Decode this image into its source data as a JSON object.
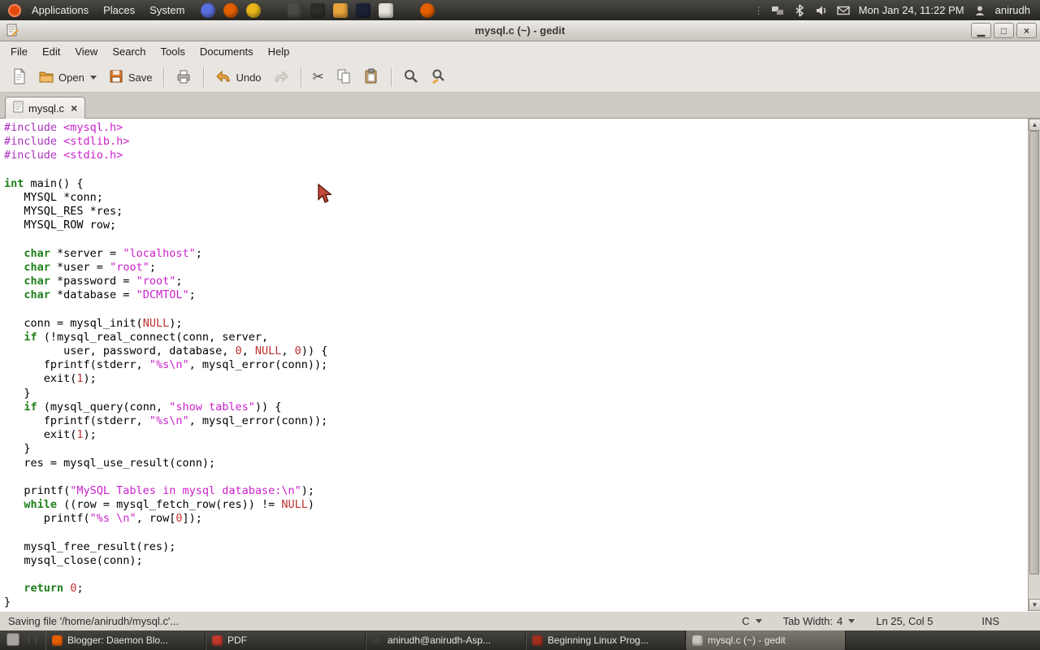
{
  "top_panel": {
    "menus": [
      "Applications",
      "Places",
      "System"
    ],
    "launchers": [
      {
        "name": "gimp-icon",
        "color": "#5b6ee1",
        "shape": "circle"
      },
      {
        "name": "firefox-icon",
        "color": "#e66000",
        "shape": "circle"
      },
      {
        "name": "software-center-icon",
        "color": "#e8b71a",
        "shape": "circle"
      },
      {
        "name": "display-icon",
        "color": "#4a4a46",
        "shape": "square",
        "gap": true
      },
      {
        "name": "terminal-launcher-icon",
        "color": "#2d2d2a",
        "shape": "square"
      },
      {
        "name": "home-folder-icon",
        "color": "#e8a33d",
        "shape": "square"
      },
      {
        "name": "screenshot-icon",
        "color": "#1c2236",
        "shape": "square"
      },
      {
        "name": "text-editor-icon",
        "color": "#e6e3da",
        "shape": "square"
      },
      {
        "name": "firefox-launcher-icon",
        "color": "#e66000",
        "shape": "circle",
        "gap": true
      }
    ],
    "indicator_icons": [
      "network-icon",
      "bluetooth-icon",
      "volume-icon",
      "mail-icon"
    ],
    "clock": "Mon Jan 24, 11:22 PM",
    "user": "anirudh"
  },
  "window": {
    "title": "mysql.c (~) - gedit",
    "menus": [
      "File",
      "Edit",
      "View",
      "Search",
      "Tools",
      "Documents",
      "Help"
    ],
    "toolbar": {
      "open_label": "Open",
      "save_label": "Save",
      "undo_label": "Undo"
    },
    "tab": {
      "label": "mysql.c"
    }
  },
  "statusbar": {
    "message": "Saving file '/home/anirudh/mysql.c'...",
    "language": "C",
    "tab_width_label": "Tab Width:",
    "tab_width": "4",
    "position": "Ln 25, Col 5",
    "mode": "INS"
  },
  "taskbar": {
    "items": [
      {
        "label": "Blogger: Daemon Blo...",
        "icon": "firefox-task-icon",
        "icon_color": "#e66000",
        "active": false
      },
      {
        "label": "PDF",
        "icon": "pdf-task-icon",
        "icon_color": "#c0392b",
        "active": false
      },
      {
        "label": "anirudh@anirudh-Asp...",
        "icon": "terminal-task-icon",
        "icon_color": "#3c3c38",
        "active": false
      },
      {
        "label": "Beginning Linux Prog...",
        "icon": "book-task-icon",
        "icon_color": "#a03020",
        "active": false
      },
      {
        "label": "mysql.c (~) - gedit",
        "icon": "gedit-task-icon",
        "icon_color": "#c9c6bf",
        "active": true
      }
    ]
  },
  "colors": {
    "keyword": "#1e8018",
    "string": "#cb21cb",
    "preprocessor": "#ab2fc0",
    "number": "#c03030",
    "panel_bg": "#2e2d2a",
    "chrome_bg": "#e9e6e1"
  },
  "code": {
    "lines": [
      [
        [
          "pp",
          "#include "
        ],
        [
          "str",
          "<mysql.h>"
        ]
      ],
      [
        [
          "pp",
          "#include "
        ],
        [
          "str",
          "<stdlib.h>"
        ]
      ],
      [
        [
          "pp",
          "#include "
        ],
        [
          "str",
          "<stdio.h>"
        ]
      ],
      [],
      [
        [
          "kw",
          "int"
        ],
        [
          "pl",
          " main() {"
        ]
      ],
      [
        [
          "pl",
          "   MYSQL *conn;"
        ]
      ],
      [
        [
          "pl",
          "   MYSQL_RES *res;"
        ]
      ],
      [
        [
          "pl",
          "   MYSQL_ROW row;"
        ]
      ],
      [],
      [
        [
          "pl",
          "   "
        ],
        [
          "kw",
          "char"
        ],
        [
          "pl",
          " *server = "
        ],
        [
          "str",
          "\"localhost\""
        ],
        [
          "pl",
          ";"
        ]
      ],
      [
        [
          "pl",
          "   "
        ],
        [
          "kw",
          "char"
        ],
        [
          "pl",
          " *user = "
        ],
        [
          "str",
          "\"root\""
        ],
        [
          "pl",
          ";"
        ]
      ],
      [
        [
          "pl",
          "   "
        ],
        [
          "kw",
          "char"
        ],
        [
          "pl",
          " *password = "
        ],
        [
          "str",
          "\"root\""
        ],
        [
          "pl",
          ";"
        ]
      ],
      [
        [
          "pl",
          "   "
        ],
        [
          "kw",
          "char"
        ],
        [
          "pl",
          " *database = "
        ],
        [
          "str",
          "\"DCMTOL\""
        ],
        [
          "pl",
          ";"
        ]
      ],
      [],
      [
        [
          "pl",
          "   conn = mysql_init("
        ],
        [
          "num",
          "NULL"
        ],
        [
          "pl",
          ");"
        ]
      ],
      [
        [
          "pl",
          "   "
        ],
        [
          "kw",
          "if"
        ],
        [
          "pl",
          " (!mysql_real_connect(conn, server,"
        ]
      ],
      [
        [
          "pl",
          "         user, password, database, "
        ],
        [
          "num",
          "0"
        ],
        [
          "pl",
          ", "
        ],
        [
          "num",
          "NULL"
        ],
        [
          "pl",
          ", "
        ],
        [
          "num",
          "0"
        ],
        [
          "pl",
          ")) {"
        ]
      ],
      [
        [
          "pl",
          "      fprintf(stderr, "
        ],
        [
          "str",
          "\"%s\\n\""
        ],
        [
          "pl",
          ", mysql_error(conn));"
        ]
      ],
      [
        [
          "pl",
          "      exit("
        ],
        [
          "num",
          "1"
        ],
        [
          "pl",
          ");"
        ]
      ],
      [
        [
          "pl",
          "   }"
        ]
      ],
      [
        [
          "pl",
          "   "
        ],
        [
          "kw",
          "if"
        ],
        [
          "pl",
          " (mysql_query(conn, "
        ],
        [
          "str",
          "\"show tables\""
        ],
        [
          "pl",
          ")) {"
        ]
      ],
      [
        [
          "pl",
          "      fprintf(stderr, "
        ],
        [
          "str",
          "\"%s\\n\""
        ],
        [
          "pl",
          ", mysql_error(conn));"
        ]
      ],
      [
        [
          "pl",
          "      exit("
        ],
        [
          "num",
          "1"
        ],
        [
          "pl",
          ");"
        ]
      ],
      [
        [
          "pl",
          "   }"
        ]
      ],
      [
        [
          "pl",
          "   res = mysql_use_result(conn);"
        ]
      ],
      [],
      [
        [
          "pl",
          "   printf("
        ],
        [
          "str",
          "\"MySQL Tables in mysql database:\\n\""
        ],
        [
          "pl",
          ");"
        ]
      ],
      [
        [
          "pl",
          "   "
        ],
        [
          "kw",
          "while"
        ],
        [
          "pl",
          " ((row = mysql_fetch_row(res)) != "
        ],
        [
          "num",
          "NULL"
        ],
        [
          "pl",
          ")"
        ]
      ],
      [
        [
          "pl",
          "      printf("
        ],
        [
          "str",
          "\"%s \\n\""
        ],
        [
          "pl",
          ", row["
        ],
        [
          "num",
          "0"
        ],
        [
          "pl",
          "]);"
        ]
      ],
      [],
      [
        [
          "pl",
          "   mysql_free_result(res);"
        ]
      ],
      [
        [
          "pl",
          "   mysql_close(conn);"
        ]
      ],
      [],
      [
        [
          "pl",
          "   "
        ],
        [
          "kw",
          "return"
        ],
        [
          "pl",
          " "
        ],
        [
          "num",
          "0"
        ],
        [
          "pl",
          ";"
        ]
      ],
      [
        [
          "pl",
          "}"
        ]
      ]
    ]
  }
}
